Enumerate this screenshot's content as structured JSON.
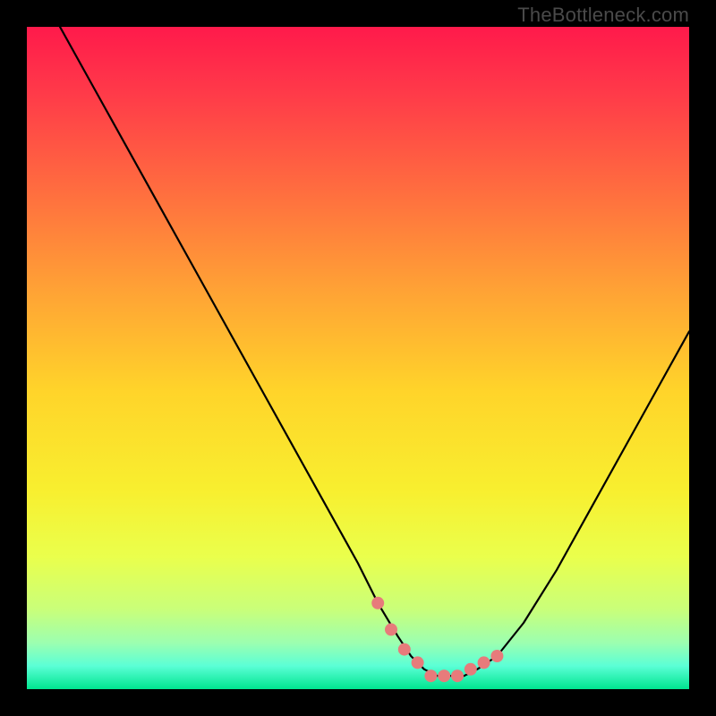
{
  "watermark": "TheBottleneck.com",
  "colors": {
    "black": "#000000",
    "marker": "#e77b7b",
    "curve": "#000000",
    "gradient_stops": [
      {
        "offset": 0.0,
        "color": "#ff1a4b"
      },
      {
        "offset": 0.1,
        "color": "#ff3a49"
      },
      {
        "offset": 0.25,
        "color": "#ff6e3f"
      },
      {
        "offset": 0.4,
        "color": "#ffa335"
      },
      {
        "offset": 0.55,
        "color": "#ffd42a"
      },
      {
        "offset": 0.7,
        "color": "#f8ef2f"
      },
      {
        "offset": 0.8,
        "color": "#eaff4c"
      },
      {
        "offset": 0.88,
        "color": "#c9ff7a"
      },
      {
        "offset": 0.93,
        "color": "#9cffb0"
      },
      {
        "offset": 0.965,
        "color": "#5bffd6"
      },
      {
        "offset": 1.0,
        "color": "#00e58f"
      }
    ]
  },
  "chart_data": {
    "type": "line",
    "title": "",
    "xlabel": "",
    "ylabel": "",
    "xlim": [
      0,
      100
    ],
    "ylim": [
      0,
      100
    ],
    "series": [
      {
        "name": "bottleneck-curve",
        "x": [
          5,
          10,
          15,
          20,
          25,
          30,
          35,
          40,
          45,
          50,
          53,
          56,
          58,
          60,
          62,
          64,
          66,
          68,
          71,
          75,
          80,
          85,
          90,
          95,
          100
        ],
        "y": [
          100,
          91,
          82,
          73,
          64,
          55,
          46,
          37,
          28,
          19,
          13,
          8,
          5,
          3,
          2,
          2,
          2,
          3,
          5,
          10,
          18,
          27,
          36,
          45,
          54
        ]
      }
    ],
    "markers": {
      "name": "highlight-dots",
      "x": [
        53,
        55,
        57,
        59,
        61,
        63,
        65,
        67,
        69,
        71
      ],
      "y": [
        13,
        9,
        6,
        4,
        2,
        2,
        2,
        3,
        4,
        5
      ]
    }
  }
}
